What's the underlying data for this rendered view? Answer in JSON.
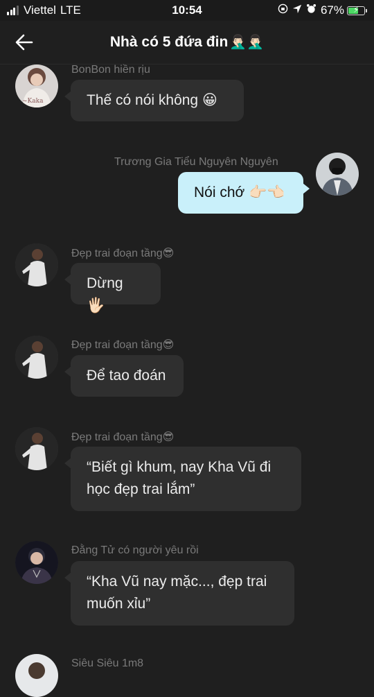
{
  "status_bar": {
    "carrier": "Viettel",
    "network": "LTE",
    "time": "10:54",
    "battery_percent": "67%",
    "battery_level": 0.67,
    "icons": [
      "signal-icon",
      "rotation-lock-icon",
      "location-icon",
      "alarm-icon",
      "battery-charging-icon"
    ]
  },
  "header": {
    "title": "Nhà có 5 đứa đin",
    "title_emoji": "🤦🏻‍♂️🤦🏻‍♂️"
  },
  "messages": [
    {
      "sender": "BonBon hiền rịu",
      "text": "Thế có nói không 😀",
      "mine": false
    },
    {
      "sender": "Trương Gia Tiểu Nguyên Nguyên",
      "text": "Nói chớ 👉🏻👈🏻",
      "mine": true
    },
    {
      "sender": "Đẹp trai đoạn tầng😎",
      "text": "Dừng 🖐🏻",
      "mine": false
    },
    {
      "sender": "Đẹp trai đoạn tầng😎",
      "text": "Để tao đoán",
      "mine": false
    },
    {
      "sender": "Đẹp trai đoạn tầng😎",
      "text": "“Biết gì khum, nay Kha Vũ đi học đẹp trai lắm”",
      "mine": false
    },
    {
      "sender": "Đằng Tử có người yêu rồi",
      "text": "“Kha Vũ nay mặc..., đẹp trai muốn xỉu”",
      "mine": false
    },
    {
      "sender": "Siêu Siêu 1m8",
      "text": "",
      "mine": false
    }
  ],
  "colors": {
    "background": "#1f1f1f",
    "bubble_incoming": "#2f2f2f",
    "bubble_outgoing": "#c9f0fa",
    "sender_text": "#7a7a7a"
  }
}
